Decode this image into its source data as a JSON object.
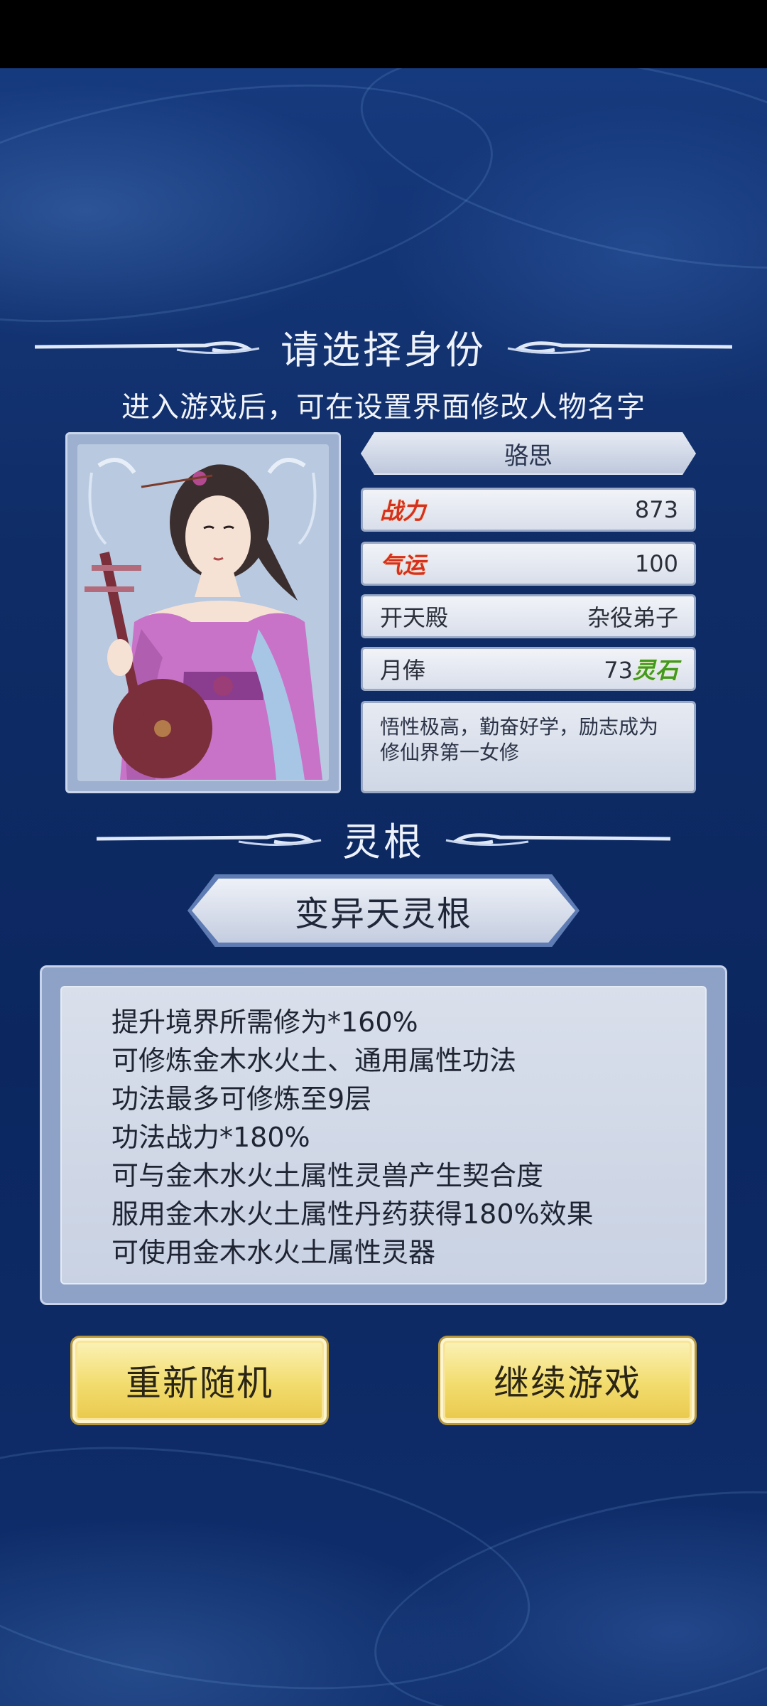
{
  "header": {
    "title": "请选择身份",
    "subtitle": "进入游戏后，可在设置界面修改人物名字"
  },
  "character": {
    "name": "骆思",
    "stats": {
      "power_label": "战力",
      "power_value": "873",
      "luck_label": "气运",
      "luck_value": "100",
      "sect_label": "开天殿",
      "sect_value": "杂役弟子",
      "salary_label": "月俸",
      "salary_value": "73",
      "salary_unit": "灵石"
    },
    "description": "悟性极高，勤奋好学，励志成为修仙界第一女修"
  },
  "spirit_root": {
    "heading": "灵根",
    "type": "变异天灵根",
    "effects": [
      "提升境界所需修为*160%",
      "可修炼金木水火土、通用属性功法",
      "功法最多可修炼至9层",
      "功法战力*180%",
      "可与金木水火土属性灵兽产生契合度",
      "服用金木水火土属性丹药获得180%效果",
      "可使用金木水火土属性灵器"
    ]
  },
  "buttons": {
    "reroll": "重新随机",
    "continue": "继续游戏"
  },
  "colors": {
    "background": "#0c2760",
    "button_gold": "#f2dc6e",
    "label_red": "#d6301f",
    "label_green": "#3f9a1f"
  }
}
